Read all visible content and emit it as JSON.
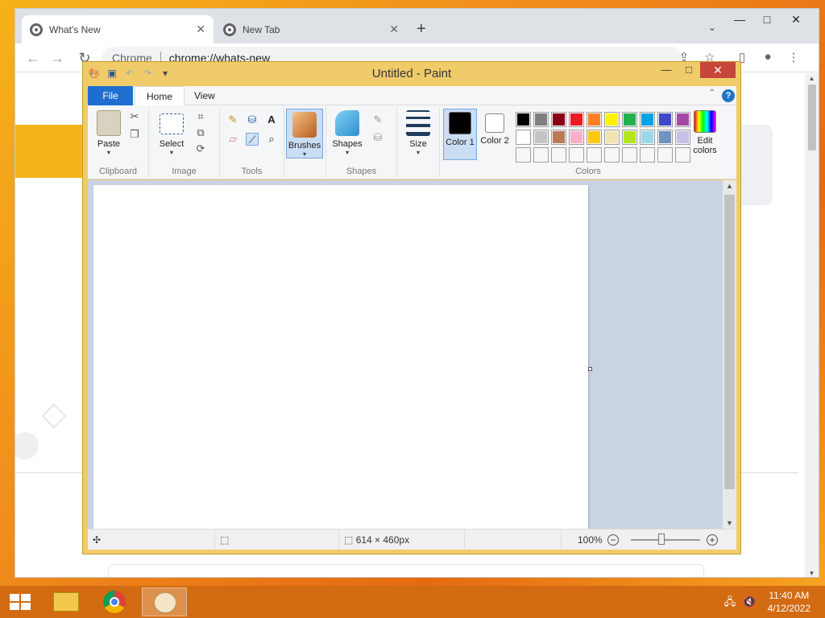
{
  "chrome": {
    "tabs": [
      {
        "label": "What's New",
        "active": true
      },
      {
        "label": "New Tab",
        "active": false
      }
    ],
    "new_tab_symbol": "+",
    "omnibox": {
      "site": "Chrome",
      "url": "chrome://whats-new"
    }
  },
  "paint": {
    "title": "Untitled - Paint",
    "menu": {
      "file": "File",
      "home": "Home",
      "view": "View"
    },
    "ribbon": {
      "clipboard": {
        "paste": "Paste",
        "label": "Clipboard"
      },
      "image": {
        "select": "Select",
        "label": "Image"
      },
      "tools": {
        "label": "Tools"
      },
      "brushes": {
        "label": "Brushes"
      },
      "shapes": {
        "shapes": "Shapes",
        "label": "Shapes"
      },
      "size": {
        "label": "Size"
      },
      "colors": {
        "color1": "Color 1",
        "color2": "Color 2",
        "edit": "Edit colors",
        "label": "Colors",
        "color1_value": "#000000",
        "color2_value": "#ffffff",
        "palette_row1": [
          "#000000",
          "#7f7f7f",
          "#880015",
          "#ed1c24",
          "#ff7f27",
          "#fff200",
          "#22b14c",
          "#00a2e8",
          "#3f48cc",
          "#a349a4"
        ],
        "palette_row2": [
          "#ffffff",
          "#c3c3c3",
          "#b97a57",
          "#ffaec9",
          "#ffc90e",
          "#efe4b0",
          "#b5e61d",
          "#99d9ea",
          "#7092be",
          "#c8bfe7"
        ],
        "palette_row3": [
          "#ffffff",
          "#ffffff",
          "#ffffff",
          "#ffffff",
          "#ffffff",
          "#ffffff",
          "#ffffff",
          "#ffffff",
          "#ffffff",
          "#ffffff"
        ]
      }
    },
    "status": {
      "dimensions": "614 × 460px",
      "zoom": "100%"
    }
  },
  "taskbar": {
    "time": "11:40 AM",
    "date": "4/12/2022"
  }
}
